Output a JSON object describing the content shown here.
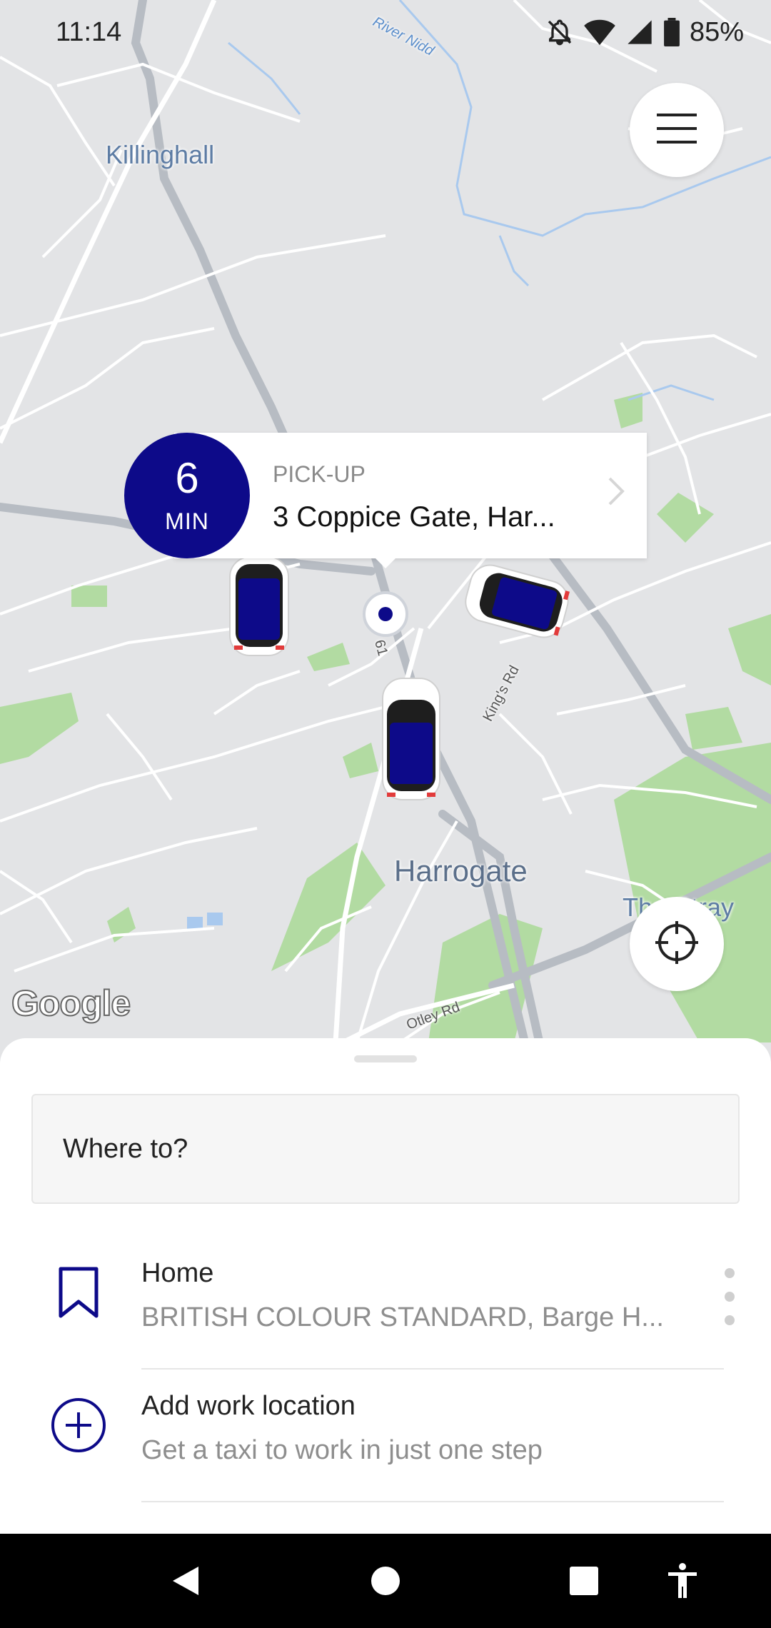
{
  "status_bar": {
    "time": "11:14",
    "battery": "85%",
    "icons": [
      "mute-icon",
      "wifi-icon",
      "signal-icon",
      "battery-icon"
    ]
  },
  "map": {
    "labels": {
      "killinghall": "Killinghall",
      "harrogate": "Harrogate",
      "the_stray": "The Stray",
      "river_nidd": "River Nidd",
      "kings_rd": "King's Rd",
      "otley_rd": "Otley Rd",
      "road_61": "61"
    },
    "attribution": "Google",
    "colors": {
      "park": "#b2dba2",
      "water": "#a9c9ee",
      "road": "#ffffff",
      "major_road": "#b7bcc3"
    }
  },
  "pickup": {
    "eta_value": "6",
    "eta_unit": "MIN",
    "label": "PICK-UP",
    "address": "3 Coppice Gate, Har..."
  },
  "sheet": {
    "search_placeholder": "Where to?",
    "saved_places": [
      {
        "title": "Home",
        "subtitle": "BRITISH COLOUR STANDARD, Barge H...",
        "icon": "bookmark-icon"
      },
      {
        "title": "Add work location",
        "subtitle": "Get a taxi to work in just one step",
        "icon": "add-circle-icon"
      }
    ]
  },
  "colors": {
    "accent": "#0d0a89"
  },
  "nav_bar": {
    "icons": [
      "back-icon",
      "home-icon",
      "recents-icon",
      "accessibility-icon"
    ]
  }
}
